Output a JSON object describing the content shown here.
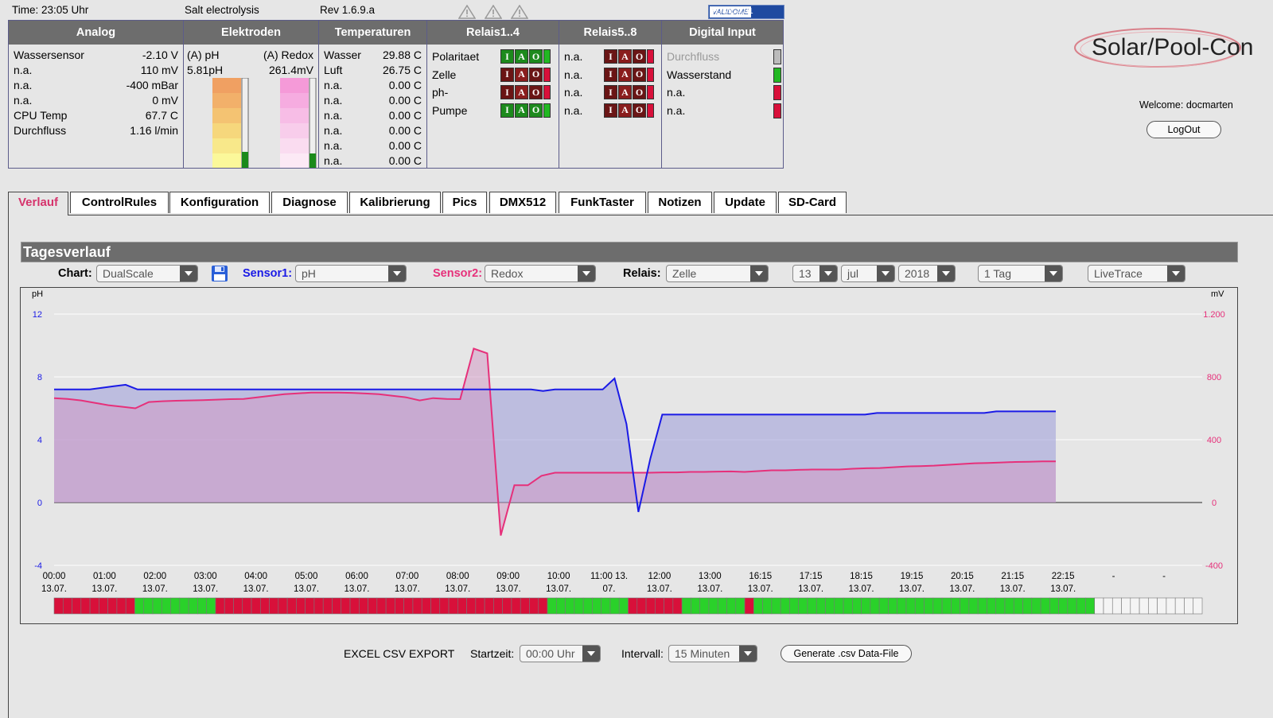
{
  "topbar": {
    "time": "Time: 23:05 Uhr",
    "mode": "Salt electrolysis",
    "rev": "Rev 1.6.9.a",
    "validome_v": "VALIDOME",
    "validome_t": "HTML 4.01"
  },
  "headers": {
    "analog": "Analog",
    "elektroden": "Elektroden",
    "temperaturen": "Temperaturen",
    "relais14": "Relais1..4",
    "relais58": "Relais5..8",
    "digital": "Digital Input"
  },
  "analog": [
    {
      "label": "Wassersensor",
      "value": "-2.10 V"
    },
    {
      "label": "n.a.",
      "value": "110 mV"
    },
    {
      "label": "n.a.",
      "value": "-400 mBar"
    },
    {
      "label": "n.a.",
      "value": "0 mV"
    },
    {
      "label": "CPU Temp",
      "value": "67.7 C"
    },
    {
      "label": "Durchfluss",
      "value": "1.16 l/min"
    }
  ],
  "elektroden": {
    "ph_label": "(A) pH",
    "redox_label": "(A) Redox",
    "ph_value": "5.81pH",
    "redox_value": "261.4mV"
  },
  "temperaturen": [
    {
      "label": "Wasser",
      "value": "29.88 C"
    },
    {
      "label": "Luft",
      "value": "26.75 C"
    },
    {
      "label": "n.a.",
      "value": "0.00 C"
    },
    {
      "label": "n.a.",
      "value": "0.00 C"
    },
    {
      "label": "n.a.",
      "value": "0.00 C"
    },
    {
      "label": "n.a.",
      "value": "0.00 C"
    },
    {
      "label": "n.a.",
      "value": "0.00 C"
    },
    {
      "label": "n.a.",
      "value": "0.00 C"
    }
  ],
  "relais14": [
    {
      "label": "Polaritaet",
      "state": "on"
    },
    {
      "label": "Zelle",
      "state": "off"
    },
    {
      "label": "ph-",
      "state": "off"
    },
    {
      "label": "Pumpe",
      "state": "on"
    }
  ],
  "relais58": [
    {
      "label": "n.a.",
      "state": "off"
    },
    {
      "label": "n.a.",
      "state": "off"
    },
    {
      "label": "n.a.",
      "state": "off"
    },
    {
      "label": "n.a.",
      "state": "off"
    }
  ],
  "relay_letters": {
    "i": "I",
    "a": "A",
    "o": "O"
  },
  "digital": [
    {
      "label": "Durchfluss",
      "state": "grey"
    },
    {
      "label": "Wasserstand",
      "state": "green"
    },
    {
      "label": "n.a.",
      "state": "red"
    },
    {
      "label": "n.a.",
      "state": "red"
    }
  ],
  "logo": {
    "text": "Solar/Pool-Con"
  },
  "user": {
    "welcome": "Welcome: docmarten",
    "logout": "LogOut"
  },
  "tabs": [
    "Verlauf",
    "ControlRules",
    "Konfiguration",
    "Diagnose",
    "Kalibrierung",
    "Pics",
    "DMX512",
    "FunkTaster",
    "Notizen",
    "Update",
    "SD-Card"
  ],
  "section": {
    "title": "Tagesverlauf"
  },
  "controls": {
    "chart_label": "Chart:",
    "chart_value": "DualScale",
    "sensor1_label": "Sensor1:",
    "sensor1_value": "pH",
    "sensor2_label": "Sensor2:",
    "sensor2_value": "Redox",
    "relais_label": "Relais:",
    "relais_value": "Zelle",
    "day": "13",
    "month": "jul",
    "year": "2018",
    "range": "1 Tag",
    "mode": "LiveTrace"
  },
  "export": {
    "title": "EXCEL CSV EXPORT",
    "start_label": "Startzeit:",
    "start_value": "00:00 Uhr",
    "interval_label": "Intervall:",
    "interval_value": "15 Minuten",
    "generate": "Generate .csv Data-File"
  },
  "colors": {
    "ph": "#1a1ae6",
    "redox": "#e6307a",
    "header": "#6d6d6d",
    "relay_on": "#22b822",
    "relay_off": "#d8103a"
  },
  "chart_data": {
    "type": "line",
    "ylabel_left": "pH",
    "ylabel_right": "mV",
    "ylim_left": [
      -4,
      12
    ],
    "ylim_right": [
      -400,
      1200
    ],
    "yticks_left": [
      "12",
      "8",
      "4",
      "0",
      "-4"
    ],
    "yticks_right": [
      "1.200",
      "800",
      "400",
      "0",
      "-400"
    ],
    "xticks": [
      [
        "00:00",
        "13.07."
      ],
      [
        "01:00",
        "13.07."
      ],
      [
        "02:00",
        "13.07."
      ],
      [
        "03:00",
        "13.07."
      ],
      [
        "04:00",
        "13.07."
      ],
      [
        "05:00",
        "13.07."
      ],
      [
        "06:00",
        "13.07."
      ],
      [
        "07:00",
        "13.07."
      ],
      [
        "08:00",
        "13.07."
      ],
      [
        "09:00",
        "13.07."
      ],
      [
        "10:00",
        "13.07."
      ],
      [
        "11:00 13.",
        "07."
      ],
      [
        "12:00",
        "13.07."
      ],
      [
        "13:00",
        "13.07."
      ],
      [
        "16:15",
        "13.07."
      ],
      [
        "17:15",
        "13.07."
      ],
      [
        "18:15",
        "13.07."
      ],
      [
        "19:15",
        "13.07."
      ],
      [
        "20:15",
        "13.07."
      ],
      [
        "21:15",
        "13.07."
      ],
      [
        "22:15",
        "13.07."
      ],
      [
        "-",
        ""
      ],
      [
        "-",
        ""
      ]
    ],
    "series": [
      {
        "name": "pH",
        "axis": "left",
        "values": [
          7.2,
          7.2,
          7.2,
          7.2,
          7.3,
          7.4,
          7.5,
          7.2,
          7.2,
          7.2,
          7.2,
          7.2,
          7.2,
          7.2,
          7.2,
          7.2,
          7.2,
          7.2,
          7.2,
          7.2,
          7.2,
          7.2,
          7.2,
          7.2,
          7.2,
          7.2,
          7.2,
          7.2,
          7.2,
          7.2,
          7.2,
          7.2,
          7.2,
          7.2,
          7.2,
          7.2,
          7.2,
          7.2,
          7.2,
          7.2,
          7.2,
          7.1,
          7.2,
          7.2,
          7.2,
          7.2,
          7.2,
          7.9,
          5.0,
          -0.6,
          2.8,
          5.6,
          5.6,
          5.6,
          5.6,
          5.6,
          5.6,
          5.6,
          5.6,
          5.6,
          5.6,
          5.6,
          5.6,
          5.6,
          5.6,
          5.6,
          5.6,
          5.6,
          5.6,
          5.7,
          5.7,
          5.7,
          5.7,
          5.7,
          5.7,
          5.7,
          5.7,
          5.7,
          5.7,
          5.8,
          5.8,
          5.8,
          5.8,
          5.8,
          5.8
        ]
      },
      {
        "name": "Redox",
        "axis": "right",
        "values": [
          665,
          660,
          650,
          635,
          620,
          610,
          600,
          640,
          645,
          648,
          650,
          652,
          655,
          658,
          660,
          670,
          680,
          690,
          695,
          700,
          700,
          700,
          698,
          694,
          690,
          680,
          670,
          650,
          665,
          660,
          658,
          980,
          950,
          -210,
          110,
          110,
          170,
          190,
          190,
          190,
          190,
          190,
          190,
          190,
          190,
          192,
          192,
          195,
          195,
          197,
          198,
          195,
          200,
          205,
          205,
          208,
          210,
          210,
          210,
          215,
          218,
          220,
          225,
          230,
          232,
          235,
          240,
          245,
          250,
          252,
          255,
          258,
          260,
          262,
          262
        ]
      }
    ],
    "relay_bar": "RRRRRRRRRGGGGGGGGGRRRRRRRRRRRRRRRRRRRRRRRRRRRRRRRRRRRRRGGGGGGGGGRRRRRRGGGGGGGRGGGGGGGGGGGGGGGGGGGGGGGGGGGGGGGGGGGGGGWWWWWWWWWWWW"
  }
}
